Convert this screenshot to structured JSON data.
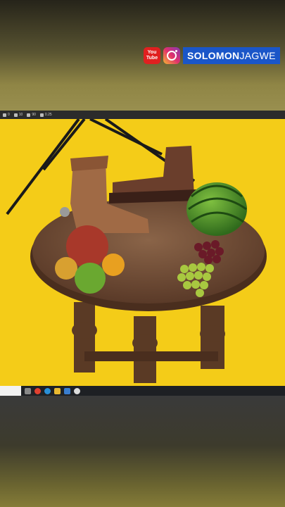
{
  "banner": {
    "youtube_line1": "You",
    "youtube_line2": "Tube",
    "channel_bold": "SOLOMON",
    "channel_thin": "JAGWE"
  },
  "toolbar": {
    "items": [
      "0",
      "10",
      "90",
      "0.25"
    ]
  },
  "colors": {
    "background": "#f4cc18",
    "banner_blue": "#1a56c8",
    "youtube_red": "#e02020"
  },
  "taskbar": {
    "icons": [
      "task-view-icon",
      "chrome-icon",
      "edge-icon",
      "file-explorer-icon",
      "store-icon",
      "unreal-icon"
    ]
  }
}
